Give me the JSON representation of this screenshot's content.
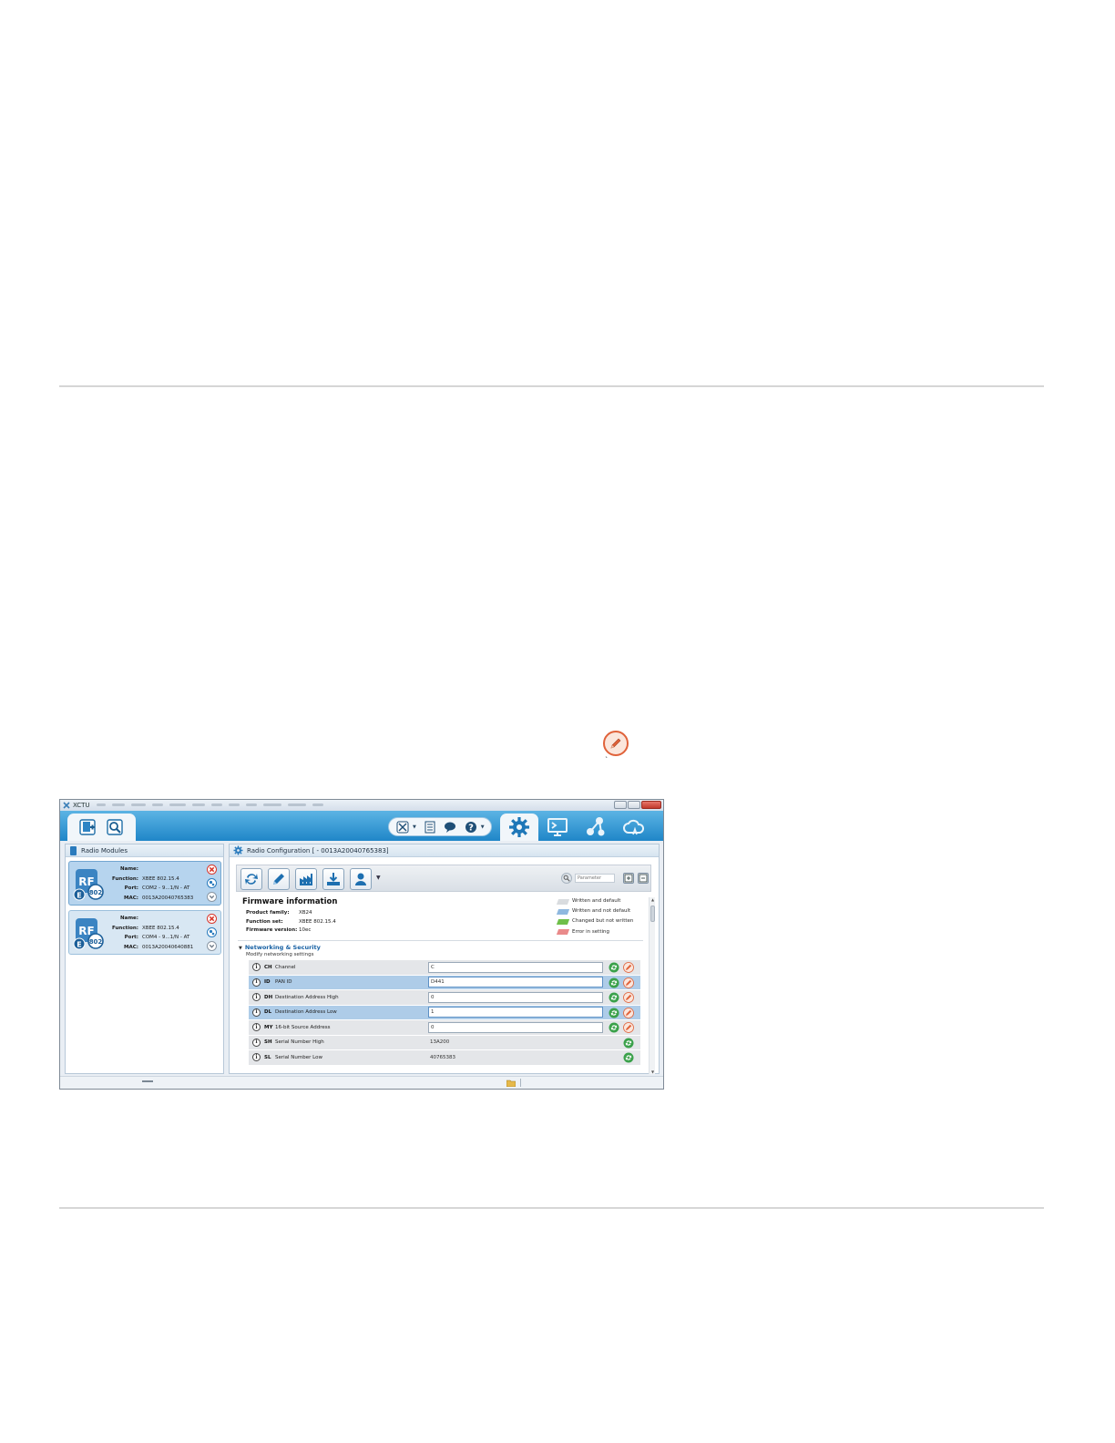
{
  "window": {
    "title": "XCTU"
  },
  "left_panel": {
    "title": "Radio Modules",
    "modules": [
      {
        "icon_top": "RF",
        "icon_badge": "802",
        "name_label": "Name:",
        "name_value": "",
        "function_label": "Function:",
        "function_value": "XBEE 802.15.4",
        "port_label": "Port:",
        "port_value": "COM2 - 9...1/N - AT",
        "mac_label": "MAC:",
        "mac_value": "0013A20040765383",
        "selected": true
      },
      {
        "icon_top": "RF",
        "icon_badge": "802",
        "name_label": "Name:",
        "name_value": "",
        "function_label": "Function:",
        "function_value": "XBEE 802.15.4",
        "port_label": "Port:",
        "port_value": "COM4 - 9...1/N - AT",
        "mac_label": "MAC:",
        "mac_value": "0013A20040640881",
        "selected": false
      }
    ]
  },
  "right_panel": {
    "title": "Radio Configuration [ - 0013A20040765383]",
    "search_placeholder": "Parameter",
    "firmware": {
      "title": "Firmware information",
      "product_family_label": "Product family:",
      "product_family_value": "XB24",
      "function_set_label": "Function set:",
      "function_set_value": "XBEE 802.15.4",
      "firmware_version_label": "Firmware version:",
      "firmware_version_value": "10ec"
    },
    "legend": [
      {
        "label": "Written and default",
        "color": "#d9dcdf"
      },
      {
        "label": "Written and not default",
        "color": "#8fb8df"
      },
      {
        "label": "Changed but not written",
        "color": "#6fbf4a"
      },
      {
        "label": "Error in setting",
        "color": "#e98a8a"
      }
    ],
    "section": {
      "title": "Networking & Security",
      "subtitle": "Modify networking settings"
    },
    "params": [
      {
        "code": "CH",
        "name": "Channel",
        "value": "C",
        "editable": true,
        "highlight": false
      },
      {
        "code": "ID",
        "name": "PAN ID",
        "value": "D441",
        "editable": true,
        "highlight": true
      },
      {
        "code": "DH",
        "name": "Destination Address High",
        "value": "0",
        "editable": true,
        "highlight": false
      },
      {
        "code": "DL",
        "name": "Destination Address Low",
        "value": "1",
        "editable": true,
        "highlight": true
      },
      {
        "code": "MY",
        "name": "16-bit Source Address",
        "value": "0",
        "editable": true,
        "highlight": false
      },
      {
        "code": "SH",
        "name": "Serial Number High",
        "value": "13A200",
        "editable": false,
        "highlight": false
      },
      {
        "code": "SL",
        "name": "Serial Number Low",
        "value": "40765383",
        "editable": false,
        "highlight": false
      }
    ]
  },
  "colors": {
    "toolbar_blue": "#1f86c8",
    "accent_orange": "#e0623a",
    "refresh_green": "#3aa14a",
    "close_red": "#d9362b"
  }
}
